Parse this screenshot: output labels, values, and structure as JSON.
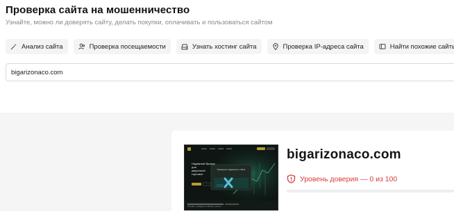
{
  "header": {
    "title": "Проверка сайта на мошенничество",
    "subtitle": "Узнайте, можно ли доверять сайту, делать покупки, оплачивать и пользоваться сайтом"
  },
  "tabs": [
    {
      "label": "Анализ сайта",
      "icon": "wand-icon"
    },
    {
      "label": "Проверка посещаемости",
      "icon": "users-icon"
    },
    {
      "label": "Узнать хостинг сайта",
      "icon": "server-icon"
    },
    {
      "label": "Проверка IP-адреса сайта",
      "icon": "location-pin-icon"
    },
    {
      "label": "Найти похожие сайты",
      "icon": "window-icon"
    }
  ],
  "search": {
    "value": "bigarizonaco.com"
  },
  "result": {
    "site_name": "bigarizonaco.com",
    "trust_label": "Уровень доверия — 0 из 100",
    "trust_score": 0,
    "trust_max": 100,
    "preview": {
      "headline_lines": [
        "Надёжный брокер для",
        "уверенной",
        "торговли"
      ],
      "popup_text": "Проверьте надёжность сайта",
      "footer_text": "Платёж, трейдинг в облаке, услуги"
    }
  },
  "colors": {
    "danger": "#d93a3a",
    "tab_bg": "#f4f4f5",
    "section_bg": "#f5f5f5"
  }
}
